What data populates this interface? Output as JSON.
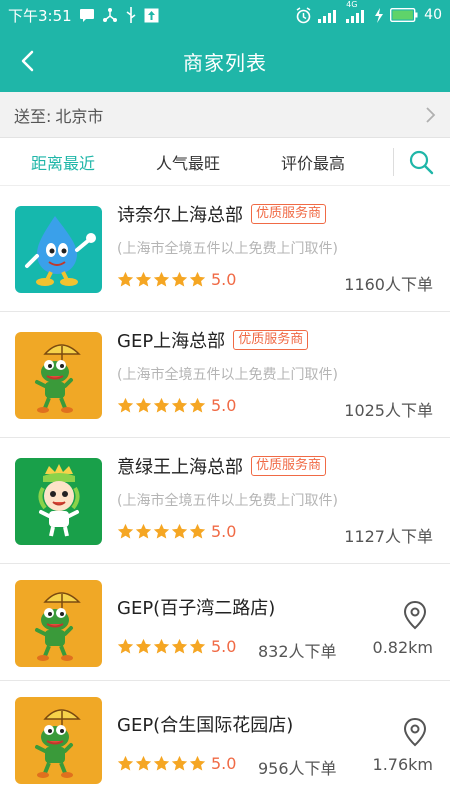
{
  "status_bar": {
    "time": "下午3:51",
    "network": "4G",
    "battery_level": "40"
  },
  "header": {
    "title": "商家列表"
  },
  "deliver": {
    "label": "送至:",
    "city": "北京市"
  },
  "tabs": [
    {
      "label": "距离最近",
      "active": true
    },
    {
      "label": "人气最旺",
      "active": false
    },
    {
      "label": "评价最高",
      "active": false
    }
  ],
  "colors": {
    "accent": "#1fb6a8",
    "badge": "#f06a45",
    "star": "#f5a623"
  },
  "merchants": [
    {
      "name": "诗奈尔上海总部",
      "badge": "优质服务商",
      "subtitle": "(上海市全境五件以上免费上门取件)",
      "score": "5.0",
      "orders": "1160人下单",
      "distance": "",
      "logo_icon": "water-drop-mascot-icon"
    },
    {
      "name": "GEP上海总部",
      "badge": "优质服务商",
      "subtitle": "(上海市全境五件以上免费上门取件)",
      "score": "5.0",
      "orders": "1025人下单",
      "distance": "",
      "logo_icon": "frog-umbrella-mascot-icon"
    },
    {
      "name": "意绿王上海总部",
      "badge": "优质服务商",
      "subtitle": "(上海市全境五件以上免费上门取件)",
      "score": "5.0",
      "orders": "1127人下单",
      "distance": "",
      "logo_icon": "leaf-king-mascot-icon"
    },
    {
      "name": "GEP(百子湾二路店)",
      "badge": "",
      "subtitle": "",
      "score": "5.0",
      "orders": "832人下单",
      "distance": "0.82km",
      "logo_icon": "frog-umbrella-mascot-icon"
    },
    {
      "name": "GEP(合生国际花园店)",
      "badge": "",
      "subtitle": "",
      "score": "5.0",
      "orders": "956人下单",
      "distance": "1.76km",
      "logo_icon": "frog-umbrella-mascot-icon"
    }
  ]
}
